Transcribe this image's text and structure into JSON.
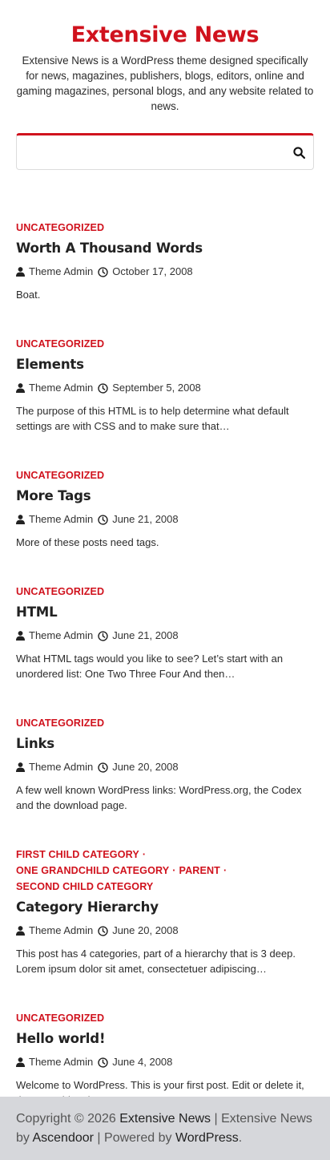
{
  "theme": {
    "accent": "#d0121d"
  },
  "site": {
    "title": "Extensive News",
    "tagline": "Extensive News is a WordPress theme designed specifically for news, magazines, publishers, blogs, editors, online and gaming magazines, personal blogs, and any website related to news."
  },
  "search": {
    "placeholder": "",
    "icon": "search-icon"
  },
  "posts": [
    {
      "categories": [
        "UNCATEGORIZED"
      ],
      "title": "Worth A Thousand Words",
      "author": "Theme Admin",
      "date": "October 17, 2008",
      "excerpt": "Boat."
    },
    {
      "categories": [
        "UNCATEGORIZED"
      ],
      "title": "Elements",
      "author": "Theme Admin",
      "date": "September 5, 2008",
      "excerpt": "The purpose of this HTML is to help determine what default settings are with CSS and to make sure that…"
    },
    {
      "categories": [
        "UNCATEGORIZED"
      ],
      "title": "More Tags",
      "author": "Theme Admin",
      "date": "June 21, 2008",
      "excerpt": "More of these posts need tags."
    },
    {
      "categories": [
        "UNCATEGORIZED"
      ],
      "title": "HTML",
      "author": "Theme Admin",
      "date": "June 21, 2008",
      "excerpt": "What HTML tags would you like to see? Let’s start with an unordered list: One Two Three Four And then…"
    },
    {
      "categories": [
        "UNCATEGORIZED"
      ],
      "title": "Links",
      "author": "Theme Admin",
      "date": "June 20, 2008",
      "excerpt": "A few well known WordPress links: WordPress.org, the Codex and the download page."
    },
    {
      "categories": [
        "FIRST CHILD CATEGORY",
        "ONE GRANDCHILD CATEGORY",
        "PARENT",
        "SECOND CHILD CATEGORY"
      ],
      "title": "Category Hierarchy",
      "author": "Theme Admin",
      "date": "June 20, 2008",
      "excerpt": "This post has 4 categories, part of a hierarchy that is 3 deep. Lorem ipsum dolor sit amet, consectetuer adipiscing…"
    },
    {
      "categories": [
        "UNCATEGORIZED"
      ],
      "title": "Hello world!",
      "author": "Theme Admin",
      "date": "June 4, 2008",
      "excerpt": "Welcome to WordPress. This is your first post. Edit or delete it, then start blogging!"
    }
  ],
  "footer": {
    "copyright_prefix": "Copyright © 2026 ",
    "site_link": "Extensive News",
    "sep1": " | Extensive News by ",
    "author_link": "Ascendoor",
    "sep2": " | Powered by ",
    "wp_link": "WordPress",
    "suffix": "."
  }
}
